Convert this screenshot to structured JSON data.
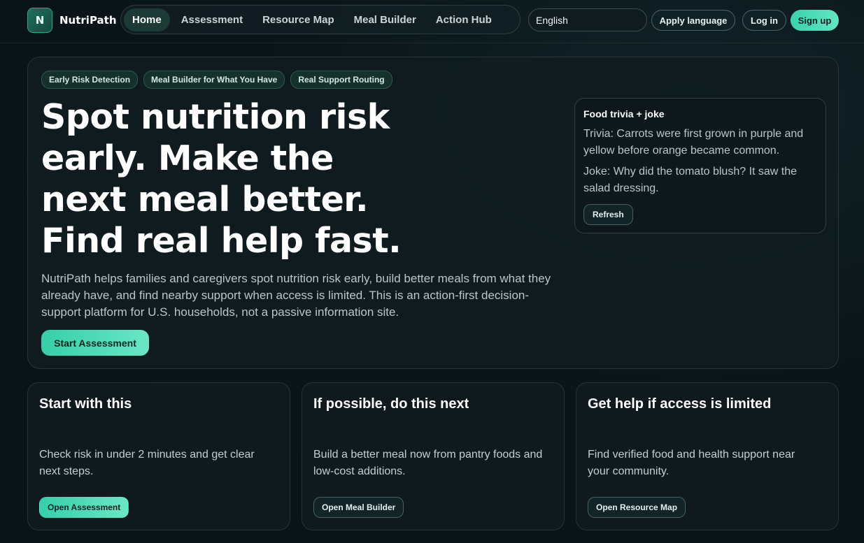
{
  "brand": {
    "logo_letter": "N",
    "name": "NutriPath"
  },
  "nav": {
    "items": [
      {
        "label": "Home",
        "active": true
      },
      {
        "label": "Assessment"
      },
      {
        "label": "Resource Map"
      },
      {
        "label": "Meal Builder"
      },
      {
        "label": "Action Hub"
      }
    ]
  },
  "header": {
    "language_value": "English",
    "apply_language_label": "Apply language",
    "login_label": "Log in",
    "signup_label": "Sign up"
  },
  "hero": {
    "tags": [
      "Early Risk Detection",
      "Meal Builder for What You Have",
      "Real Support Routing"
    ],
    "title": "Spot nutrition risk early. Make the next meal better. Find real help fast.",
    "description": "NutriPath helps families and caregivers spot nutrition risk early, build better meals from what they already have, and find nearby support when access is limited. This is an action-first decision-support platform for U.S. households, not a passive information site.",
    "cta_label": "Start Assessment"
  },
  "trivia": {
    "title": "Food trivia + joke",
    "trivia": "Trivia: Carrots were first grown in purple and yellow before orange became common.",
    "joke": "Joke: Why did the tomato blush? It saw the salad dressing.",
    "refresh_label": "Refresh"
  },
  "cards": [
    {
      "title": "Start with this",
      "text": "Check risk in under 2 minutes and get clear next steps.",
      "button": "Open Assessment"
    },
    {
      "title": "If possible, do this next",
      "text": "Build a better meal now from pantry foods and low-cost additions.",
      "button": "Open Meal Builder"
    },
    {
      "title": "Get help if access is limited",
      "text": "Find verified food and health support near your community.",
      "button": "Open Resource Map"
    }
  ],
  "colors": {
    "accent": "#39d3ad",
    "background": "#0b1519",
    "panel": "#111c20"
  }
}
